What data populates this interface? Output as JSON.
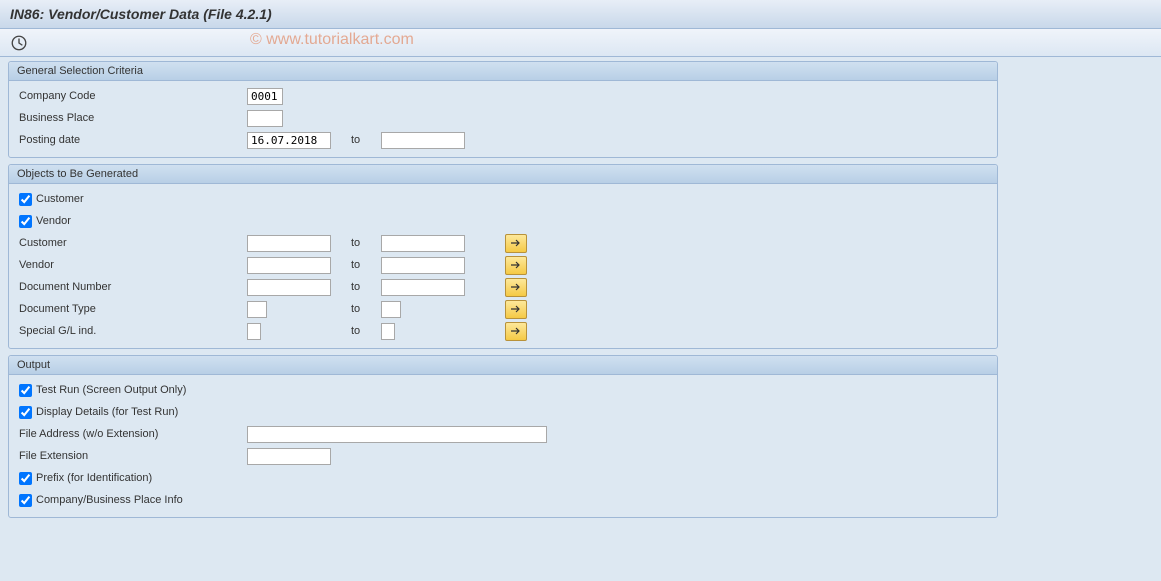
{
  "title": "IN86: Vendor/Customer Data (File 4.2.1)",
  "watermark": "© www.tutorialkart.com",
  "general": {
    "header": "General Selection Criteria",
    "company_code_label": "Company Code",
    "company_code_value": "0001",
    "business_place_label": "Business Place",
    "business_place_value": "",
    "posting_date_label": "Posting date",
    "posting_date_from": "16.07.2018",
    "to_label": "to",
    "posting_date_to": ""
  },
  "objects": {
    "header": "Objects to Be Generated",
    "customer_cb_label": "Customer",
    "vendor_cb_label": "Vendor",
    "customer_label": "Customer",
    "vendor_label": "Vendor",
    "docnum_label": "Document Number",
    "doctype_label": "Document Type",
    "specialgl_label": "Special G/L ind.",
    "to_label": "to"
  },
  "output": {
    "header": "Output",
    "testrun_label": "Test Run (Screen Output Only)",
    "display_details_label": "Display Details (for Test Run)",
    "file_address_label": "File Address (w/o Extension)",
    "file_address_value": "",
    "file_ext_label": "File Extension",
    "file_ext_value": "",
    "prefix_label": "Prefix (for Identification)",
    "company_info_label": "Company/Business Place Info"
  }
}
